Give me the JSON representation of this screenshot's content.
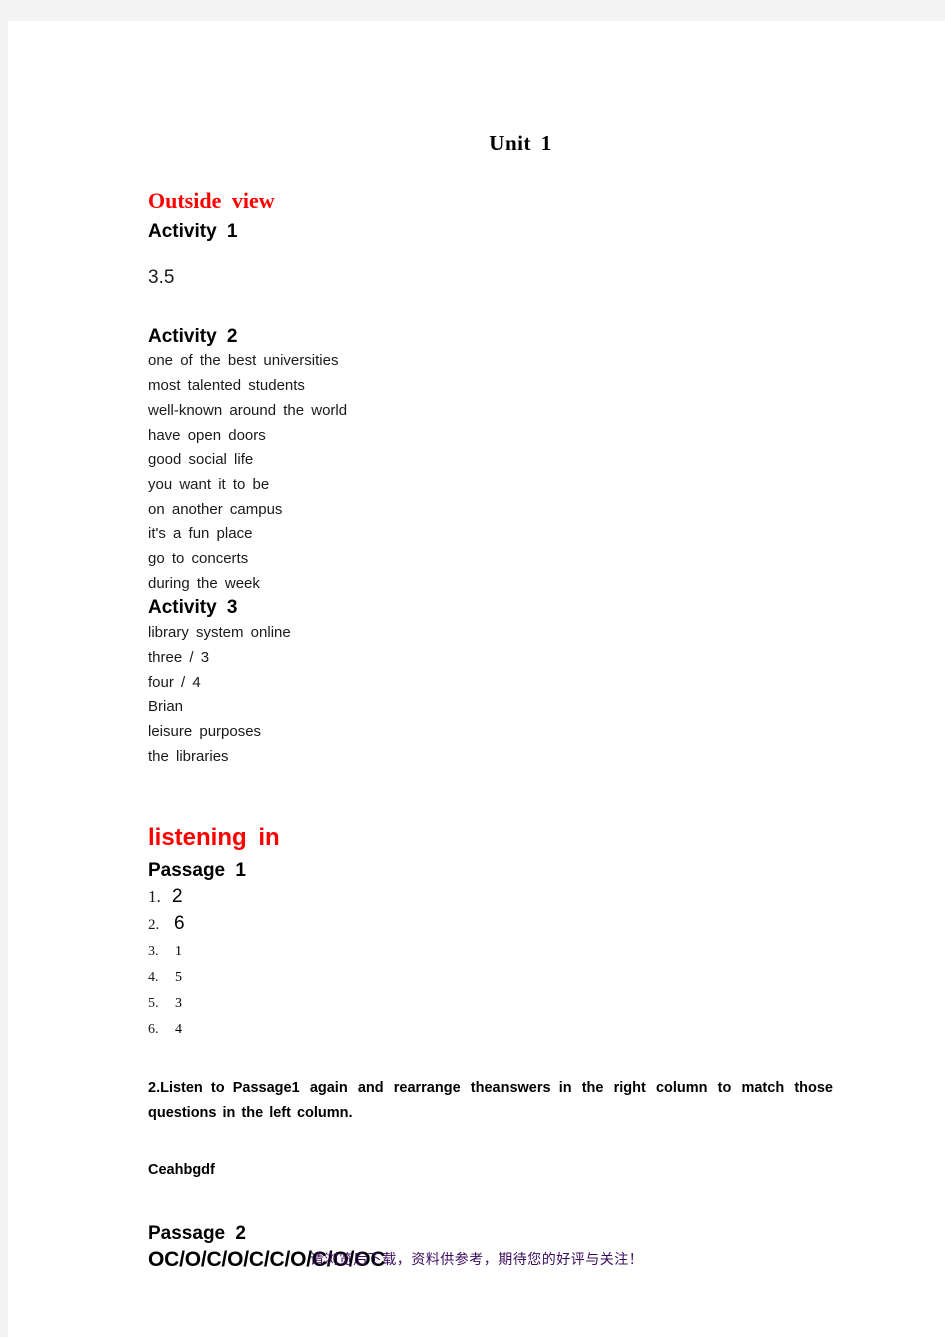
{
  "document": {
    "unit_title": "Unit 1"
  },
  "outside_view": {
    "section_title": "Outside view",
    "activity1": {
      "heading": "Activity 1",
      "answer": "3.5"
    },
    "activity2": {
      "heading": "Activity 2",
      "answers": [
        "one of the best universities",
        "most talented students",
        "well-known around the world",
        "have open doors",
        "good social life",
        "you want it to be",
        "on another campus",
        "it's a fun place",
        "go to concerts",
        "during the week"
      ]
    },
    "activity3": {
      "heading": "Activity 3",
      "answers": [
        "library system online",
        "three / 3",
        "four / 4",
        "Brian",
        "leisure purposes",
        "the libraries"
      ]
    }
  },
  "listening_in": {
    "section_title": "listening in",
    "passage1": {
      "heading": "Passage 1",
      "numbered_answers": [
        {
          "marker": "1.",
          "value": "2"
        },
        {
          "marker": "2.",
          "value": "6"
        },
        {
          "marker": "3.",
          "value": "1"
        },
        {
          "marker": "4.",
          "value": "5"
        },
        {
          "marker": "5.",
          "value": "3"
        },
        {
          "marker": "6.",
          "value": "4"
        }
      ],
      "instruction_part1": "2.Listen to Passage",
      "instruction_part2": "1",
      "instruction_part3": " again and rearrange the",
      "instruction_part4": "answers in",
      "instruction_part5": " the right column to match those questions in the left column.",
      "sequence_answer": "Ceahbgdf"
    },
    "passage2": {
      "heading": "Passage 2",
      "sequence_answer": "OC/O/C/O/C/C/O/C/O/OC"
    }
  },
  "footer": {
    "watermark": "请浏览后下载，资料供参考，期待您的好评与关注！"
  },
  "colors": {
    "page_background": "#f4f4f4",
    "paper": "#ffffff",
    "heading_red": "#ff0000",
    "body_text": "#1a1a1a",
    "watermark": "#3b0b5c"
  }
}
